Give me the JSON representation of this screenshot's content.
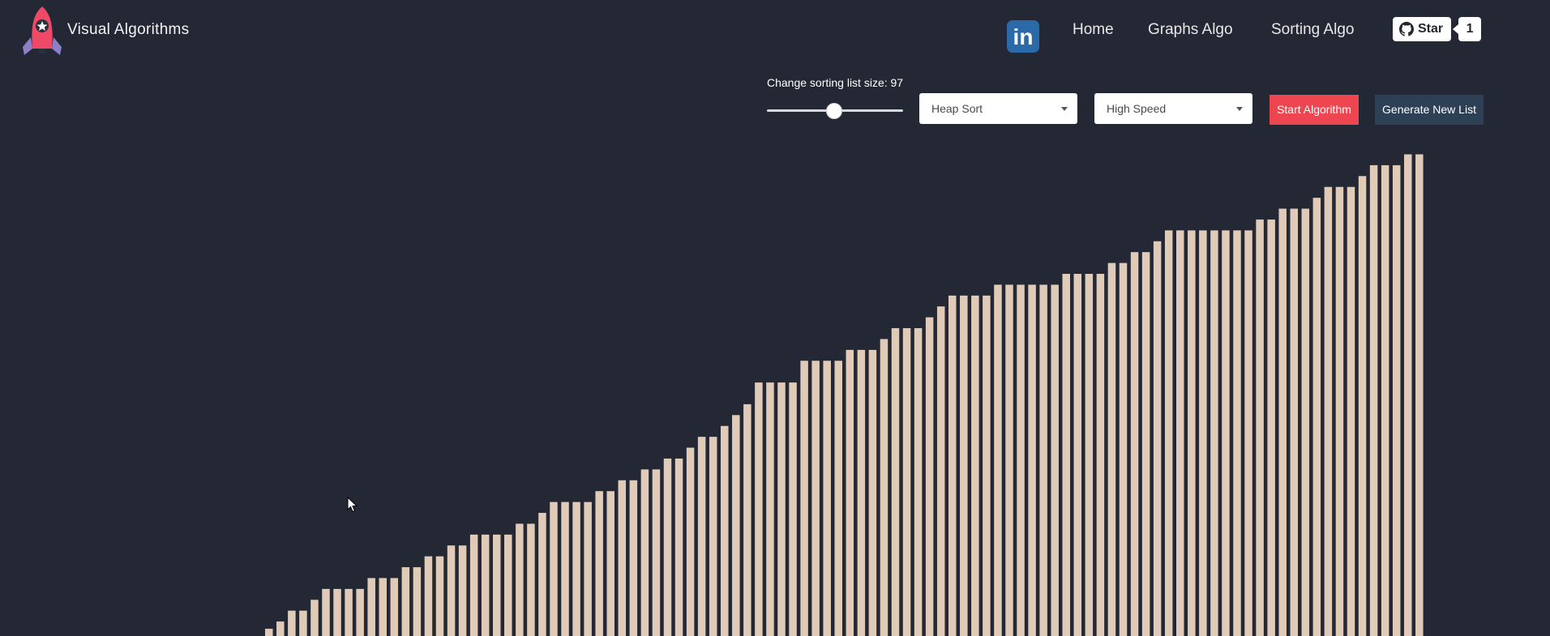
{
  "header": {
    "brand": "Visual Algorithms",
    "logo_icon": "rocket-icon",
    "linkedin_icon": "linkedin-icon",
    "nav": [
      "Home",
      "Graphs Algo",
      "Sorting Algo"
    ],
    "github": {
      "icon": "github-icon",
      "star_label": "Star",
      "star_count": "1"
    }
  },
  "controls": {
    "size_label": "Change sorting list size: 97",
    "slider_value": 97,
    "algorithm_select": "Heap Sort",
    "speed_select": "High Speed",
    "start_button": "Start Algorithm",
    "generate_button": "Generate New List"
  },
  "colors": {
    "background": "#232834",
    "bar": "#e0cbb8",
    "start_button": "#ee4650",
    "generate_button": "#2e4055",
    "linkedin": "#2b6aa8"
  },
  "chart_data": {
    "type": "bar",
    "values": [
      2,
      4,
      7,
      7,
      10,
      13,
      13,
      13,
      13,
      16,
      16,
      16,
      19,
      19,
      22,
      22,
      25,
      25,
      28,
      28,
      28,
      28,
      31,
      31,
      34,
      37,
      37,
      37,
      37,
      40,
      40,
      43,
      43,
      46,
      46,
      49,
      49,
      52,
      55,
      55,
      58,
      61,
      64,
      70,
      70,
      70,
      70,
      76,
      76,
      76,
      76,
      79,
      79,
      79,
      82,
      85,
      85,
      85,
      88,
      91,
      94,
      94,
      94,
      94,
      97,
      97,
      97,
      97,
      97,
      97,
      100,
      100,
      100,
      100,
      103,
      103,
      106,
      106,
      109,
      112,
      112,
      112,
      112,
      112,
      112,
      112,
      112,
      115,
      115,
      118,
      118,
      118,
      121,
      124,
      124,
      124,
      127,
      130,
      130,
      130,
      133,
      133
    ]
  }
}
